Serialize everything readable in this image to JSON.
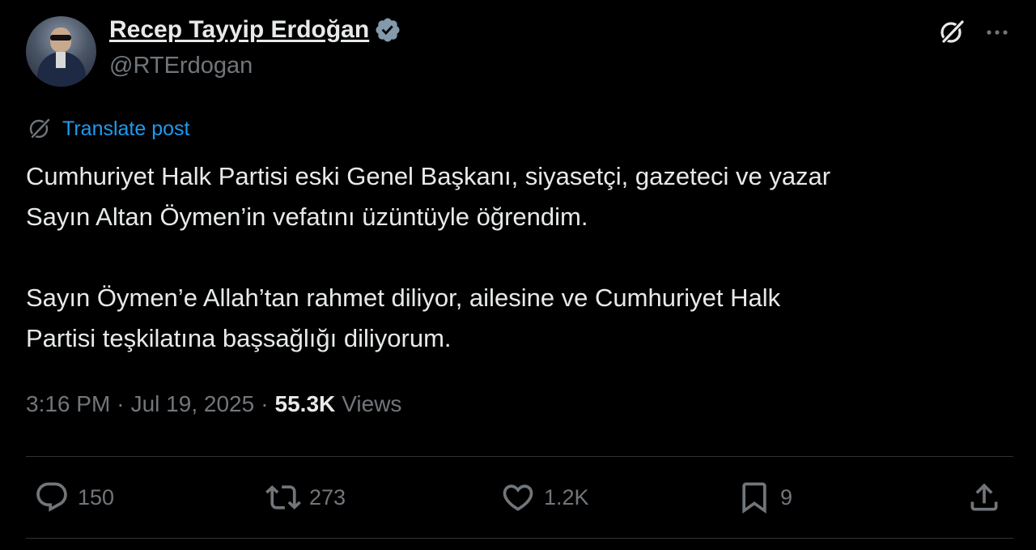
{
  "author": {
    "display_name": "Recep Tayyip Erdoğan",
    "handle": "@RTErdogan",
    "verified": true,
    "verified_color": "#829aab"
  },
  "translate": {
    "label": "Translate post",
    "color": "#1d9bf0"
  },
  "post": {
    "text": "Cumhuriyet Halk Partisi eski Genel Başkanı, siyasetçi, gazeteci ve yazar\nSayın Altan Öymen’in vefatını üzüntüyle öğrendim.\n\nSayın Öymen’e Allah’tan rahmet diliyor, ailesine ve Cumhuriyet Halk\nPartisi teşkilatına başsağlığı diliyorum."
  },
  "meta": {
    "time": "3:16 PM",
    "separator": "·",
    "date": "Jul 19, 2025",
    "views_count": "55.3K",
    "views_label": "Views"
  },
  "actions": {
    "reply": {
      "icon": "reply-icon",
      "count": "150"
    },
    "repost": {
      "icon": "repost-icon",
      "count": "273"
    },
    "like": {
      "icon": "heart-icon",
      "count": "1.2K"
    },
    "bookmark": {
      "icon": "bookmark-icon",
      "count": "9"
    },
    "share": {
      "icon": "share-icon"
    }
  },
  "header_icons": {
    "grok": "grok-icon",
    "more": "more-icon"
  }
}
